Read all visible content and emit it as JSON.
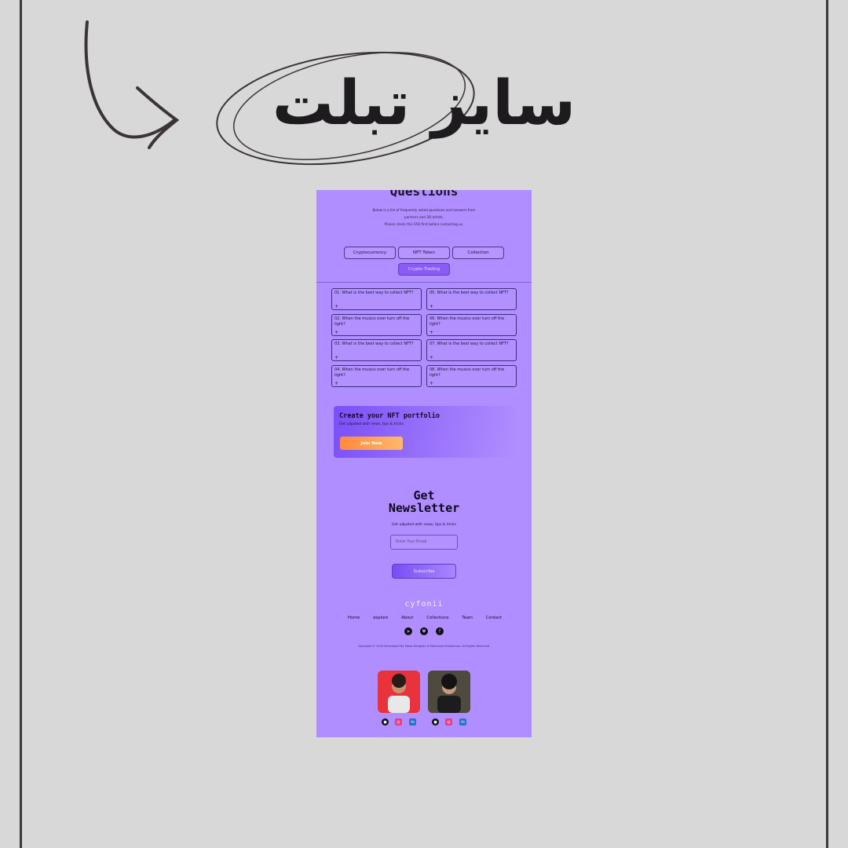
{
  "header": {
    "title": "سایز تبلت"
  },
  "faq_section": {
    "title": "Questions",
    "subtitle_lines": [
      "Below is a list of frequently asked questions and answers from",
      "partners and 3D artists.",
      "Please check this FAQ first before contacting us."
    ],
    "categories": [
      "Cryptocurrency",
      "NFT Token",
      "Collection",
      "Crypto Trading"
    ],
    "active_category": "Crypto Trading",
    "questions": [
      {
        "label": "01. What is the best way to collect NFT?",
        "icon": "+"
      },
      {
        "label": "02. When the musics over turn off the light?",
        "icon": "+"
      },
      {
        "label": "03. What is the best way to collect NFT?",
        "icon": "+"
      },
      {
        "label": "04. When the musics over turn off the light?",
        "icon": "+"
      },
      {
        "label": "05. What is the best way to collect NFT?",
        "icon": "+"
      },
      {
        "label": "06. When the musics over turn off the light?",
        "icon": "+"
      },
      {
        "label": "07. What is the best way to collect NFT?",
        "icon": "+"
      },
      {
        "label": "08. When the musics over turn off the light?",
        "icon": "+"
      }
    ]
  },
  "cta": {
    "title": "Create your NFT portfolio",
    "subtitle": "Get udpated with news, tips & tricks",
    "button": "Join Now"
  },
  "newsletter": {
    "title_line1": "Get",
    "title_line2": "Newsletter",
    "subtitle": "Get udpated with news, tips & tricks",
    "input_placeholder": "Enter Your Email",
    "button": "Subscribe"
  },
  "footer": {
    "logo": "cyfonii",
    "nav": [
      "Home",
      "explore",
      "About",
      "Collections",
      "Team",
      "Contact"
    ],
    "social_icons": [
      "telegram-icon",
      "twitter-icon",
      "facebook-icon"
    ],
    "copyright": "Copyright © 2023 Developed By Fatoo Dehghan & Mohamad Ghasemon. All Rights Reserved."
  },
  "team": {
    "members": [
      {
        "avatar_color": "#e8323c",
        "icons": [
          "github-icon",
          "instagram-icon",
          "linkedin-icon"
        ]
      },
      {
        "avatar_color": "#2b2a2e",
        "icons": [
          "github-icon",
          "instagram-icon",
          "linkedin-icon"
        ]
      }
    ]
  },
  "colors": {
    "background": "#d8d8d8",
    "page": "#b18eff",
    "accent": "#7b4ff7",
    "cta_button": "#ff8a3d"
  }
}
